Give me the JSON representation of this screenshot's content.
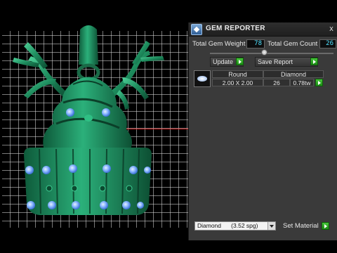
{
  "viewport": {
    "model_name_icon": "cupcake-pendant-model"
  },
  "panel": {
    "title": "GEM REPORTER",
    "close_label": "x",
    "total_weight_label": "Total Gem Weight",
    "total_weight_value": "78",
    "total_count_label": "Total Gem Count",
    "total_count_value": "26",
    "update_label": "Update",
    "save_report_label": "Save Report",
    "table": {
      "columns": [
        "Round",
        "Diamond"
      ],
      "rows": [
        {
          "size": "2.00 X 2.00",
          "count": "26",
          "weight": "0.78tw"
        }
      ]
    },
    "material_selected": "Diamond      (3.52 spg)",
    "set_material_label": "Set Material"
  },
  "colors": {
    "viewport_bg": "#000000",
    "grid": "#dcdcdc",
    "model_green": "#1f8a5c",
    "gem_blue": "#7fb4ff",
    "panel_bg": "#3a3a3a",
    "value_text": "#4fe0ff",
    "go_button": "#2aa81f",
    "axis_red": "#d02020"
  }
}
